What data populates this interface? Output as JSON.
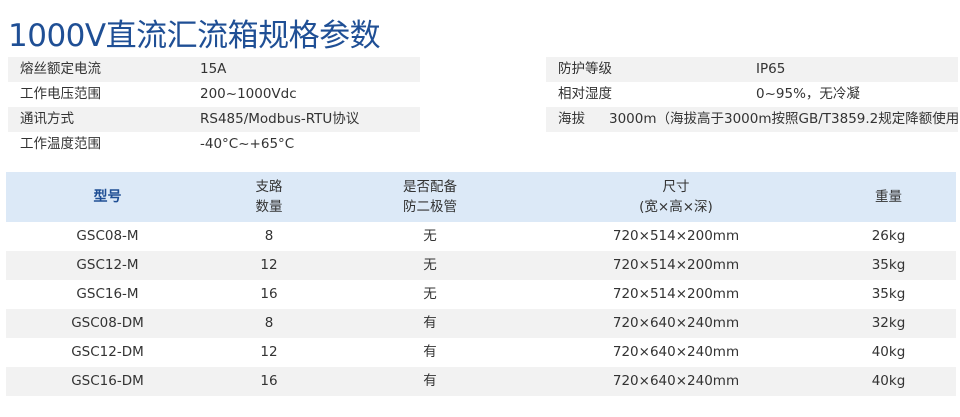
{
  "page": {
    "title": "1000V直流汇流箱规格参数"
  },
  "specs_left": [
    {
      "label": "熔丝额定电流",
      "value": "15A"
    },
    {
      "label": "工作电压范围",
      "value": "200~1000Vdc"
    },
    {
      "label": "通讯方式",
      "value": "RS485/Modbus-RTU协议"
    },
    {
      "label": "工作温度范围",
      "value": "-40°C~+65°C"
    }
  ],
  "specs_right": [
    {
      "label": "防护等级",
      "value": "IP65"
    },
    {
      "label": "相对湿度",
      "value": "0~95%，无冷凝"
    },
    {
      "label": "海拔",
      "value": "3000m（海拔高于3000m按照GB/T3859.2规定降额使用）"
    }
  ],
  "table": {
    "headers": {
      "model": "型号",
      "branches_l1": "支路",
      "branches_l2": "数量",
      "diode_l1": "是否配备",
      "diode_l2": "防二极管",
      "size_l1": "尺寸",
      "size_l2": "(宽×高×深)",
      "weight": "重量"
    },
    "rows": [
      {
        "model": "GSC08-M",
        "branches": "8",
        "diode": "无",
        "size": "720×514×200mm",
        "weight": "26kg"
      },
      {
        "model": "GSC12-M",
        "branches": "12",
        "diode": "无",
        "size": "720×514×200mm",
        "weight": "35kg"
      },
      {
        "model": "GSC16-M",
        "branches": "16",
        "diode": "无",
        "size": "720×514×200mm",
        "weight": "35kg"
      },
      {
        "model": "GSC08-DM",
        "branches": "8",
        "diode": "有",
        "size": "720×640×240mm",
        "weight": "32kg"
      },
      {
        "model": "GSC12-DM",
        "branches": "12",
        "diode": "有",
        "size": "720×640×240mm",
        "weight": "40kg"
      },
      {
        "model": "GSC16-DM",
        "branches": "16",
        "diode": "有",
        "size": "720×640×240mm",
        "weight": "40kg"
      }
    ]
  }
}
